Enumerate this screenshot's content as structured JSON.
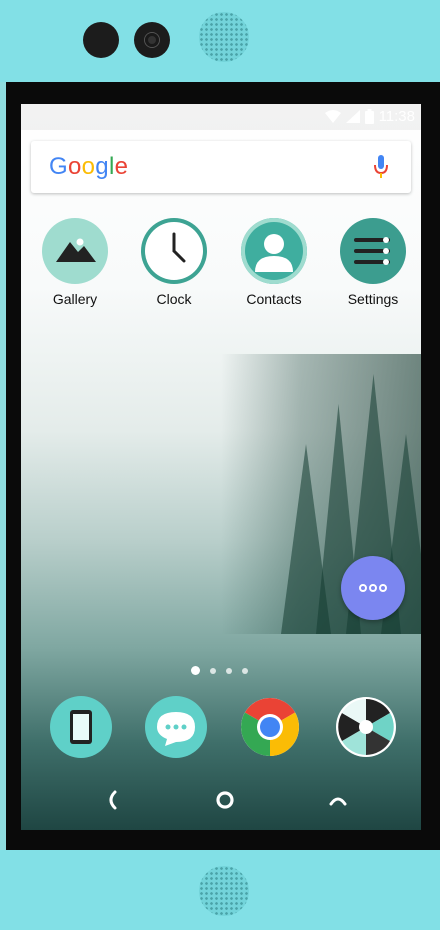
{
  "status_bar": {
    "time": "11:38",
    "icons": [
      "wifi-icon",
      "cell-signal-icon",
      "battery-icon"
    ]
  },
  "search": {
    "logo": "Google",
    "logo_letters": [
      "G",
      "o",
      "o",
      "g",
      "l",
      "e"
    ],
    "logo_colors": [
      "#4285F4",
      "#EA4335",
      "#FBBC05",
      "#4285F4",
      "#34A853",
      "#EA4335"
    ],
    "mic_icon": "mic-icon"
  },
  "apps": [
    {
      "label": "Gallery",
      "icon": "mountain-icon",
      "color": "#7fd3c6"
    },
    {
      "label": "Clock",
      "icon": "clock-icon",
      "color": "#ffffff"
    },
    {
      "label": "Contacts",
      "icon": "person-icon",
      "color": "#3fae9f"
    },
    {
      "label": "Settings",
      "icon": "sliders-icon",
      "color": "#3c9d8f"
    }
  ],
  "page_indicator": {
    "pages": 4,
    "current": 1
  },
  "fab": {
    "icon": "more-horizontal-icon",
    "color": "#7b86f0"
  },
  "dock": [
    {
      "icon": "phone-device-icon",
      "color": "#5fd0c8"
    },
    {
      "icon": "chat-bubble-icon",
      "color": "#5fd0c8"
    },
    {
      "icon": "chrome-icon",
      "color": "#ffffff"
    },
    {
      "icon": "camera-aperture-icon",
      "color": "#ffffff"
    }
  ],
  "nav": {
    "back": "back-icon",
    "home": "home-icon",
    "recents": "recents-icon"
  },
  "device_color": "#82e0e6"
}
